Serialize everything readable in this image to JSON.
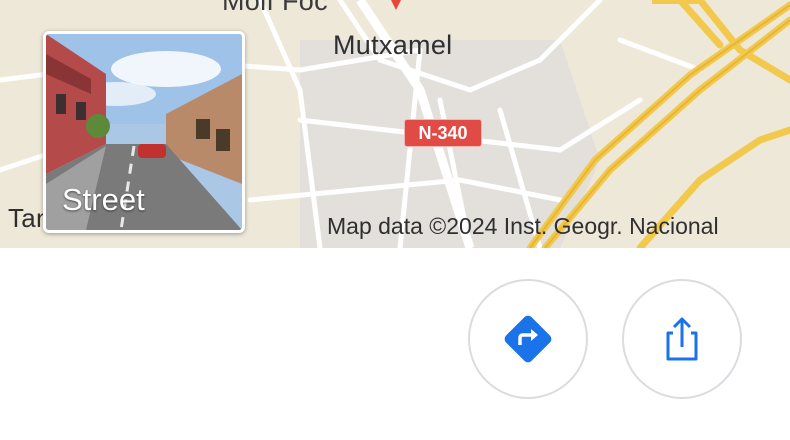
{
  "map": {
    "places": {
      "top_partial": "Molí Foc",
      "mutxamel": "Mutxamel",
      "bottom_left_partial": "Tanger"
    },
    "road_shield": "N-340",
    "attribution": "Map data ©2024 Inst. Geogr. Nacional",
    "colors": {
      "background": "#eee8d8",
      "minor_roads": "#ffffff",
      "highway": "#f2c94c",
      "shield": "#e04b45",
      "pin": "#e8453c"
    },
    "pin_icon": "location-pin-icon"
  },
  "street_view": {
    "label": "Street",
    "icon": "street-view-thumbnail"
  },
  "actions": {
    "directions_icon": "directions-icon",
    "share_icon": "share-icon",
    "accent_color": "#1a73e8"
  }
}
